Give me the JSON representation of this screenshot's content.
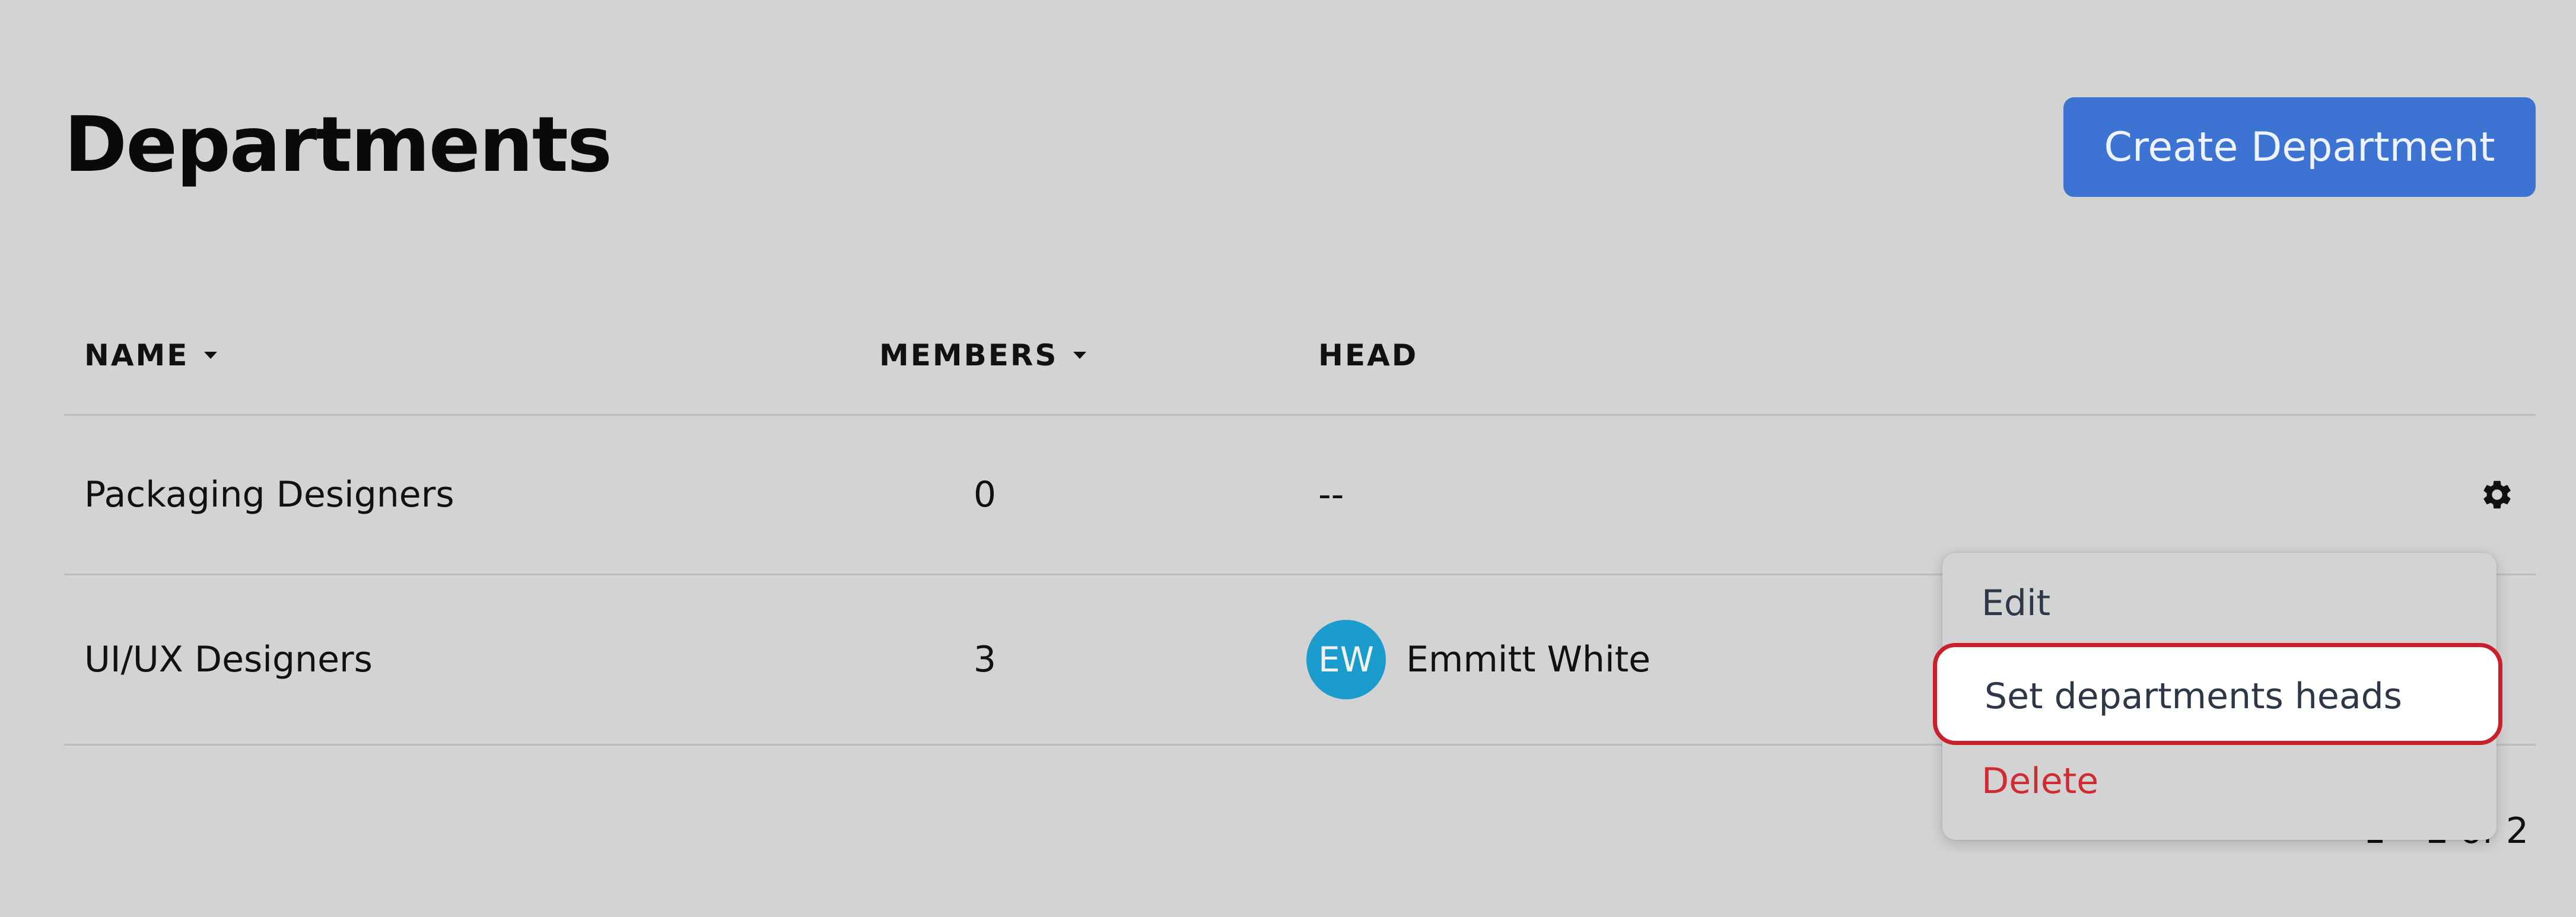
{
  "page": {
    "title": "Departments",
    "create_button_label": "Create Department"
  },
  "table": {
    "columns": {
      "name": "NAME",
      "members": "MEMBERS",
      "head": "HEAD"
    },
    "rows": [
      {
        "name": "Packaging Designers",
        "members": "0",
        "head": "--"
      },
      {
        "name": "UI/UX Designers",
        "members": "3",
        "head_initials": "EW",
        "head": "Emmitt White"
      }
    ]
  },
  "actions_menu": {
    "items": [
      "Edit",
      "Set departments heads",
      "Delete"
    ]
  },
  "pagination": {
    "label": "1 – 2 of 2"
  },
  "colors": {
    "primary": "#3d74d3",
    "danger": "#d02a32",
    "avatar": "#1a9ccc",
    "highlight": "#cc1f2c"
  },
  "icons": {
    "row_settings": "gear-icon",
    "sort": "caret-down-icon"
  }
}
